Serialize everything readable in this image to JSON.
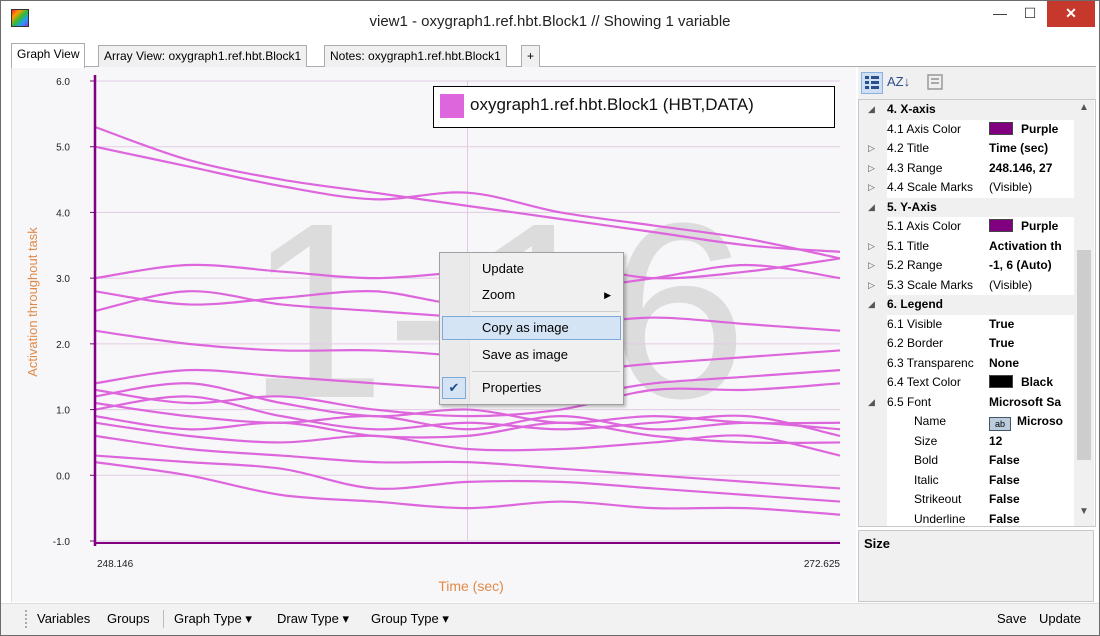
{
  "window": {
    "title": "view1 - oxygraph1.ref.hbt.Block1 // Showing 1 variable",
    "minimize": "—",
    "maximize": "☐",
    "close": "✕"
  },
  "tabs": [
    {
      "label": "Graph View",
      "active": true
    },
    {
      "label": "Array View: oxygraph1.ref.hbt.Block1",
      "active": false
    },
    {
      "label": "Notes: oxygraph1.ref.hbt.Block1",
      "active": false
    },
    {
      "label": "+",
      "active": false
    }
  ],
  "chart": {
    "watermark": "1-16",
    "series_color": "#dd66dd",
    "axis_color": "#800080"
  },
  "chart_data": {
    "type": "line",
    "title": "",
    "xlabel": "Time (sec)",
    "ylabel": "Activation throughout task",
    "xlim": [
      248.146,
      272.625
    ],
    "ylim": [
      -1,
      6
    ],
    "x_ticks": [
      "248.146",
      "272.625"
    ],
    "y_ticks": [
      "6.0",
      "5.0",
      "4.0",
      "3.0",
      "2.0",
      "1.0",
      "0.0",
      "-1.0"
    ],
    "grid": true,
    "legend": {
      "placement": "top-right",
      "entries": [
        "oxygraph1.ref.hbt.Block1 (HBT,DATA)"
      ]
    },
    "x": [
      248.146,
      251.206,
      254.266,
      257.326,
      260.386,
      263.446,
      266.505,
      269.565,
      272.625
    ],
    "series": [
      {
        "values": [
          5.3,
          4.8,
          4.5,
          4.3,
          4.1,
          3.9,
          3.7,
          3.5,
          3.4
        ]
      },
      {
        "values": [
          5.0,
          4.7,
          4.4,
          4.2,
          4.3,
          4.0,
          3.8,
          3.6,
          3.3
        ]
      },
      {
        "values": [
          3.0,
          3.2,
          3.1,
          3.0,
          3.1,
          3.2,
          3.0,
          3.1,
          3.3
        ]
      },
      {
        "values": [
          2.8,
          2.6,
          2.7,
          2.8,
          2.6,
          2.8,
          3.0,
          3.2,
          3.0
        ]
      },
      {
        "values": [
          2.5,
          2.8,
          2.6,
          2.5,
          2.4,
          2.3,
          2.4,
          2.3,
          2.2
        ]
      },
      {
        "values": [
          2.2,
          2.0,
          1.9,
          1.9,
          1.8,
          1.6,
          1.7,
          1.8,
          1.9
        ]
      },
      {
        "values": [
          1.4,
          1.6,
          1.5,
          1.4,
          1.3,
          1.2,
          1.4,
          1.5,
          1.6
        ]
      },
      {
        "values": [
          1.3,
          1.1,
          1.2,
          1.0,
          0.9,
          1.0,
          1.3,
          1.3,
          1.4
        ]
      },
      {
        "values": [
          1.2,
          1.4,
          1.1,
          0.9,
          1.0,
          0.8,
          0.9,
          0.8,
          0.8
        ]
      },
      {
        "values": [
          1.1,
          0.9,
          0.8,
          0.9,
          0.7,
          0.9,
          0.7,
          0.8,
          0.7
        ]
      },
      {
        "values": [
          1.0,
          1.2,
          0.9,
          0.7,
          0.8,
          0.7,
          0.8,
          0.9,
          0.6
        ]
      },
      {
        "values": [
          0.9,
          0.7,
          0.8,
          0.6,
          0.6,
          0.8,
          0.6,
          0.5,
          0.5
        ]
      },
      {
        "values": [
          0.8,
          0.6,
          0.5,
          0.6,
          0.4,
          0.4,
          0.5,
          0.6,
          0.3
        ]
      },
      {
        "values": [
          0.6,
          0.4,
          0.3,
          0.2,
          0.2,
          0.1,
          0.0,
          -0.1,
          -0.2
        ]
      },
      {
        "values": [
          0.3,
          0.2,
          0.1,
          -0.2,
          -0.1,
          -0.1,
          -0.2,
          -0.3,
          -0.4
        ]
      },
      {
        "values": [
          0.2,
          0.0,
          -0.3,
          -0.4,
          -0.5,
          -0.4,
          -0.5,
          -0.5,
          -0.6
        ]
      }
    ]
  },
  "context_menu": {
    "items": [
      "Update",
      "Zoom",
      "Copy as image",
      "Save as image",
      "Properties"
    ],
    "submenu_arrow": "▶",
    "check": "✔"
  },
  "property_toolbar": {
    "categorized_icon": "categorized-icon",
    "alpha_icon": "AZ↓",
    "pages_icon": "property-pages-icon"
  },
  "properties": [
    {
      "kind": "cat",
      "name": "4. X-axis",
      "expander": "◢"
    },
    {
      "kind": "prop",
      "name": "4.1 Axis Color",
      "value": "Purple",
      "swatch": "#800080"
    },
    {
      "kind": "prop",
      "name": "4.2 Title",
      "value": "Time (sec)",
      "expander": "▷"
    },
    {
      "kind": "prop",
      "name": "4.3 Range",
      "value": "248.146, 27",
      "expander": "▷"
    },
    {
      "kind": "prop",
      "name": "4.4 Scale Marks",
      "value": "(Visible)",
      "expander": "▷",
      "plain": true
    },
    {
      "kind": "cat",
      "name": "5. Y-Axis",
      "expander": "◢"
    },
    {
      "kind": "prop",
      "name": "5.1 Axis Color",
      "value": "Purple",
      "swatch": "#800080"
    },
    {
      "kind": "prop",
      "name": "5.1 Title",
      "value": "Activation th",
      "expander": "▷"
    },
    {
      "kind": "prop",
      "name": "5.2 Range",
      "value": "-1, 6 (Auto)",
      "expander": "▷"
    },
    {
      "kind": "prop",
      "name": "5.3 Scale Marks",
      "value": "(Visible)",
      "expander": "▷",
      "plain": true
    },
    {
      "kind": "cat",
      "name": "6. Legend",
      "expander": "◢"
    },
    {
      "kind": "prop",
      "name": "6.1 Visible",
      "value": "True"
    },
    {
      "kind": "prop",
      "name": "6.2 Border",
      "value": "True"
    },
    {
      "kind": "prop",
      "name": "6.3 Transparenc",
      "value": "None"
    },
    {
      "kind": "prop",
      "name": "6.4 Text Color",
      "value": "Black",
      "swatch": "#000000"
    },
    {
      "kind": "prop",
      "name": "6.5 Font",
      "value": "Microsoft Sa",
      "expander": "◢"
    },
    {
      "kind": "sub",
      "name": "Name",
      "value": "Microso",
      "fonticon": "ab"
    },
    {
      "kind": "sub",
      "name": "Size",
      "value": "12"
    },
    {
      "kind": "sub",
      "name": "Bold",
      "value": "False"
    },
    {
      "kind": "sub",
      "name": "Italic",
      "value": "False"
    },
    {
      "kind": "sub",
      "name": "Strikeout",
      "value": "False"
    },
    {
      "kind": "sub",
      "name": "Underline",
      "value": "False"
    }
  ],
  "description": {
    "title": "Size"
  },
  "statusbar": {
    "variables": "Variables",
    "groups": "Groups",
    "graph_type": "Graph Type",
    "draw_type": "Draw Type",
    "group_type": "Group Type",
    "dropdown_arrow": "▾",
    "save": "Save",
    "update": "Update"
  }
}
